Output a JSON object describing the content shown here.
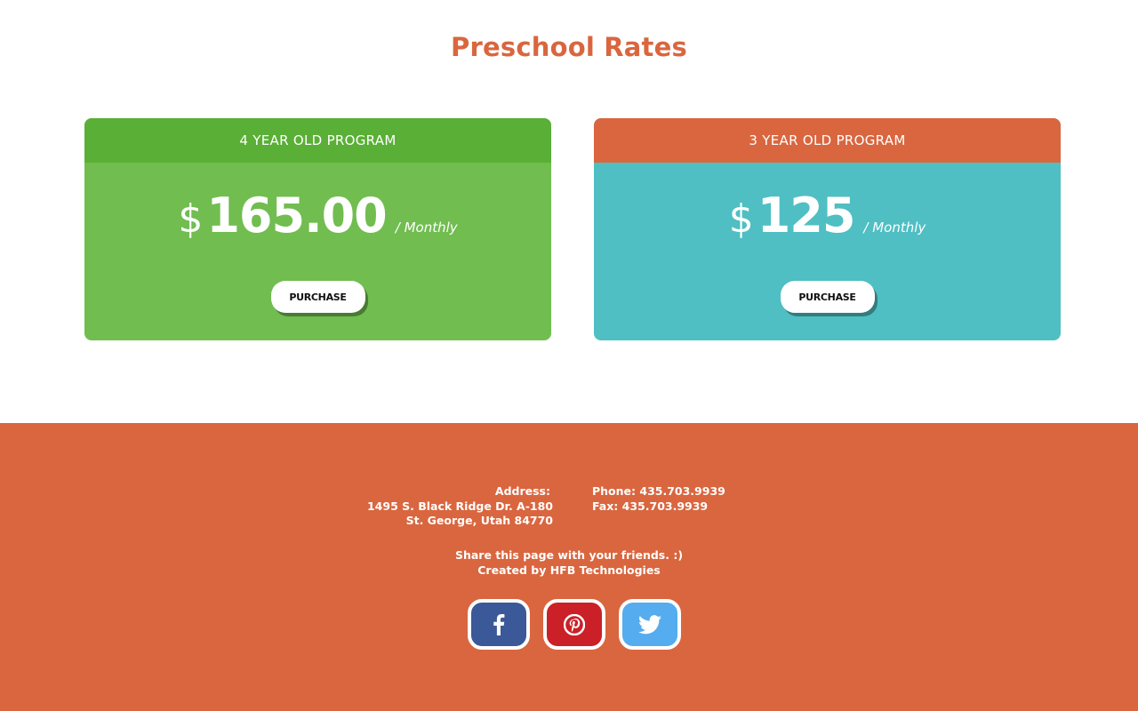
{
  "page": {
    "title": "Preschool Rates"
  },
  "plans": [
    {
      "name": "4 YEAR OLD PROGRAM",
      "currency": "$",
      "amount": "165.00",
      "period": "/ Monthly",
      "button": "PURCHASE"
    },
    {
      "name": "3 YEAR OLD PROGRAM",
      "currency": "$",
      "amount": "125",
      "period": "/ Monthly",
      "button": "PURCHASE"
    }
  ],
  "footer": {
    "address_label": "Address:",
    "address_line1": "1495 S. Black Ridge Dr. A-180",
    "address_line2": "St. George, Utah 84770",
    "phone": "Phone: 435.703.9939",
    "fax": "Fax: 435.703.9939",
    "share_text": "Share this page with your friends. :)",
    "credit": "Created by HFB Technologies",
    "social": [
      {
        "name": "facebook-icon",
        "color": "#3b5998"
      },
      {
        "name": "pinterest-icon",
        "color": "#cb2027"
      },
      {
        "name": "twitter-icon",
        "color": "#55acee"
      }
    ]
  },
  "colors": {
    "accent_orange": "#d9663f",
    "green_card": "#71bd50",
    "green_header": "#5aaf36",
    "teal_card": "#4fbfc3"
  }
}
